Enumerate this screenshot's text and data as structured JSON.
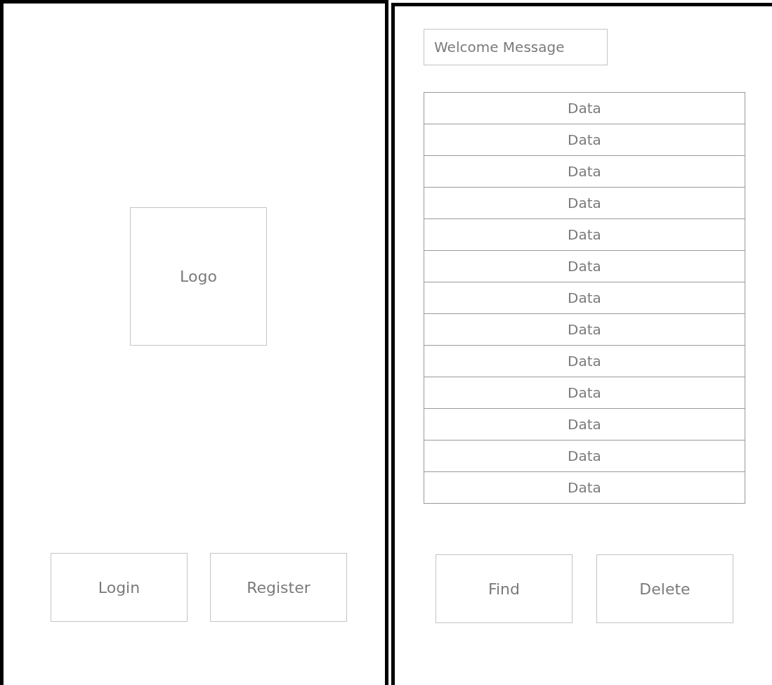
{
  "login_screen": {
    "logo": "Logo",
    "buttons": [
      "Login",
      "Register"
    ]
  },
  "data_screen": {
    "welcome_field": {
      "value": "Welcome Message"
    },
    "rows": [
      "Data",
      "Data",
      "Data",
      "Data",
      "Data",
      "Data",
      "Data",
      "Data",
      "Data",
      "Data",
      "Data",
      "Data",
      "Data"
    ],
    "buttons": [
      "Find",
      "Delete"
    ]
  }
}
